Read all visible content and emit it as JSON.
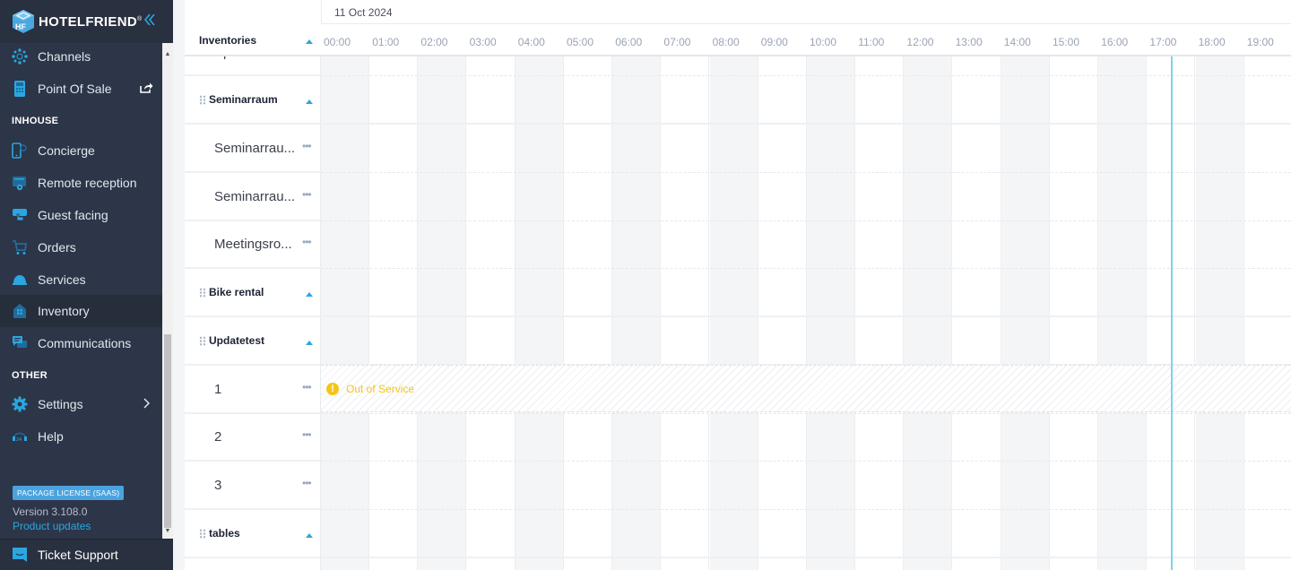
{
  "sidebar": {
    "brand": "HOTELFRIEND",
    "brand_mark": "®",
    "collapse_icon": "double-chevron-left-icon",
    "items_top": [
      {
        "label": "Channels",
        "icon": "channels-icon"
      },
      {
        "label": "Point Of Sale",
        "icon": "pos-terminal-icon",
        "trail_icon": "external-share-icon"
      }
    ],
    "section_inhouse": "INHOUSE",
    "items_inhouse": [
      {
        "label": "Concierge",
        "icon": "phone-gear-icon"
      },
      {
        "label": "Remote reception",
        "icon": "monitor-gear-icon"
      },
      {
        "label": "Guest facing",
        "icon": "hand-tablet-icon"
      },
      {
        "label": "Orders",
        "icon": "cart-icon"
      },
      {
        "label": "Services",
        "icon": "service-bell-icon"
      },
      {
        "label": "Inventory",
        "icon": "inventory-house-icon",
        "active": true
      },
      {
        "label": "Communications",
        "icon": "chat-bubbles-icon"
      }
    ],
    "section_other": "OTHER",
    "items_other": [
      {
        "label": "Settings",
        "icon": "gear-icon",
        "trail_icon": "chevron-right-icon"
      },
      {
        "label": "Help",
        "icon": "headset-24-icon"
      }
    ],
    "license_badge": "PACKAGE LICENSE (SAAS)",
    "version": "Version 3.108.0",
    "product_updates": "Product updates",
    "ticket_support": "Ticket Support"
  },
  "colors": {
    "sidebar_bg": "#2d3548",
    "accent": "#2aa7e0",
    "out_of_service": "#f5c518",
    "now_line": "#7dd3ea"
  },
  "scheduler": {
    "column_header": "Inventories",
    "date": "11 Oct 2024",
    "hours": [
      "00:00",
      "01:00",
      "02:00",
      "03:00",
      "04:00",
      "05:00",
      "06:00",
      "07:00",
      "08:00",
      "09:00",
      "10:00",
      "11:00",
      "12:00",
      "13:00",
      "14:00",
      "15:00",
      "16:00",
      "17:00",
      "18:00",
      "19:00"
    ],
    "rows": [
      {
        "type": "child",
        "label": "Spielfeld ..."
      },
      {
        "type": "group",
        "label": "Seminarraum"
      },
      {
        "type": "child",
        "label": "Seminarrau..."
      },
      {
        "type": "child",
        "label": "Seminarrau..."
      },
      {
        "type": "child",
        "label": "Meetingsro..."
      },
      {
        "type": "group",
        "label": "Bike rental"
      },
      {
        "type": "group",
        "label": "Updatetest"
      },
      {
        "type": "child",
        "label": "1"
      },
      {
        "type": "child",
        "label": "2"
      },
      {
        "type": "child",
        "label": "3"
      },
      {
        "type": "group",
        "label": "tables"
      }
    ],
    "out_of_service": {
      "label": "Out of Service",
      "row": "1",
      "icon": "exclamation-circle-icon"
    },
    "current_time_approx": "17:10"
  }
}
